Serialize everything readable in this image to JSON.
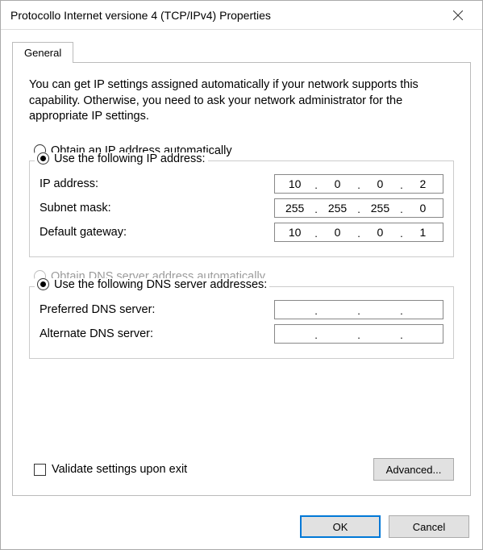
{
  "window": {
    "title": "Protocollo Internet versione 4 (TCP/IPv4) Properties"
  },
  "tabs": {
    "general": "General"
  },
  "description": "You can get IP settings assigned automatically if your network supports this capability. Otherwise, you need to ask your network administrator for the appropriate IP settings.",
  "ip": {
    "radio_auto": "Obtain an IP address automatically",
    "radio_manual": "Use the following IP address:",
    "label_ip": "IP address:",
    "label_subnet": "Subnet mask:",
    "label_gateway": "Default gateway:",
    "ip1": "10",
    "ip2": "0",
    "ip3": "0",
    "ip4": "2",
    "sn1": "255",
    "sn2": "255",
    "sn3": "255",
    "sn4": "0",
    "gw1": "10",
    "gw2": "0",
    "gw3": "0",
    "gw4": "1"
  },
  "dns": {
    "radio_auto": "Obtain DNS server address automatically",
    "radio_manual": "Use the following DNS server addresses:",
    "label_pref": "Preferred DNS server:",
    "label_alt": "Alternate DNS server:",
    "p1": "",
    "p2": "",
    "p3": "",
    "p4": "",
    "a1": "",
    "a2": "",
    "a3": "",
    "a4": ""
  },
  "validate_label": "Validate settings upon exit",
  "buttons": {
    "advanced": "Advanced...",
    "ok": "OK",
    "cancel": "Cancel"
  }
}
